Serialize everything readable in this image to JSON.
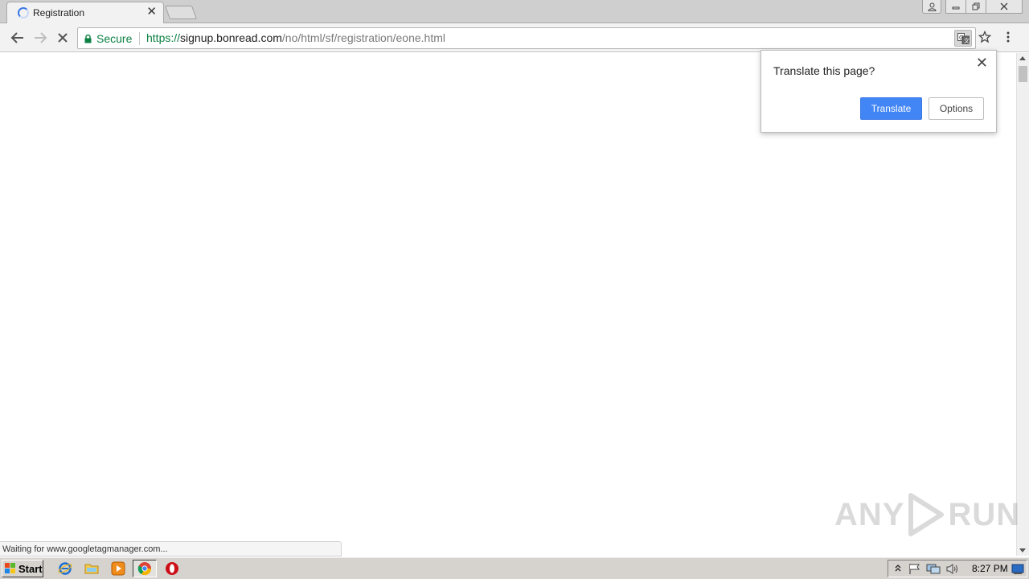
{
  "browser": {
    "tab": {
      "title": "Registration",
      "close_glyph": "✕"
    },
    "window_controls": {
      "profile_icon": "person-icon",
      "minimize_icon": "minimize-icon",
      "restore_icon": "restore-icon",
      "close_icon": "close-icon"
    },
    "toolbar": {
      "back_icon": "arrow-left-icon",
      "forward_icon": "arrow-right-icon",
      "stop_icon": "stop-x-icon",
      "secure_label": "Secure",
      "url": {
        "scheme": "https://",
        "host": "signup.bonread.com",
        "path": "/no/html/sf/registration/eone.html"
      },
      "translate_icon": "translate-icon",
      "bookmark_icon": "star-icon",
      "menu_icon": "kebab-menu-icon"
    }
  },
  "translate_bubble": {
    "title": "Translate this page?",
    "translate_label": "Translate",
    "options_label": "Options",
    "close_glyph": "✕"
  },
  "status_bar": {
    "text": "Waiting for www.googletagmanager.com..."
  },
  "watermark": {
    "left": "ANY",
    "right": "RUN"
  },
  "taskbar": {
    "start_label": "Start",
    "pinned": [
      "internet-explorer-icon",
      "file-explorer-icon",
      "media-player-icon",
      "chrome-icon",
      "opera-icon"
    ],
    "clock": "8:27 PM"
  },
  "colors": {
    "accent": "#4285f4",
    "secure_green": "#0b8043",
    "taskbar": "#d6d3ce"
  }
}
